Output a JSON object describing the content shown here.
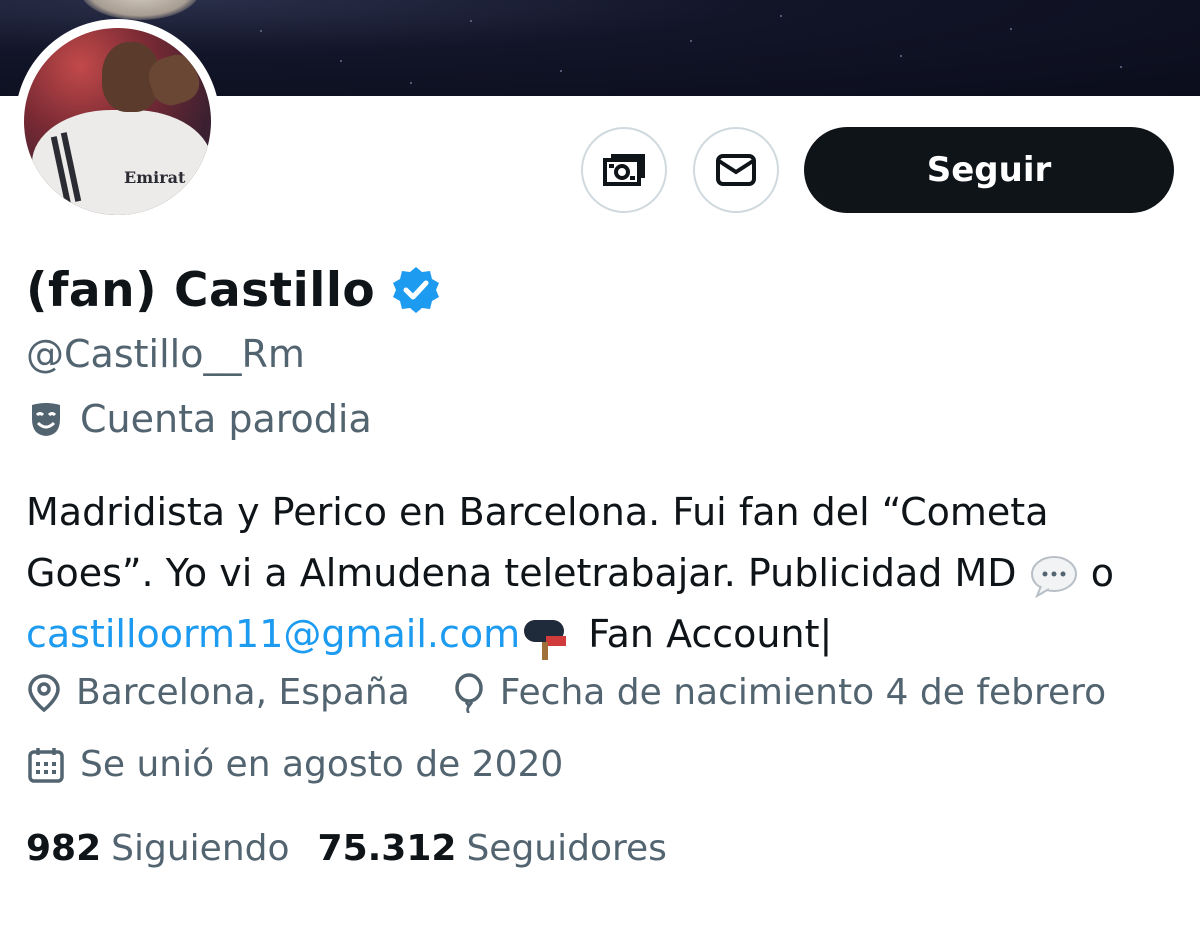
{
  "profile": {
    "name": "(fan) Castillo",
    "handle": "@Castillo__Rm",
    "label": "Cuenta parodia",
    "bio_line1": "Madridista y Perico en Barcelona. Fui fan del “Cometa",
    "bio_line2": "Goes”. Yo vi a Almudena teletrabajar. Publicidad MD",
    "bio_line2_suffix": "o",
    "bio_email": "castilloorm11@gmail.com",
    "bio_line3_suffix": "Fan Account|",
    "location": "Barcelona, España",
    "birthday": "Fecha de nacimiento 4 de febrero",
    "joined": "Se unió en agosto de 2020",
    "following_count": "982",
    "following_label": "Siguiendo",
    "followers_count": "75.312",
    "followers_label": "Seguidores",
    "avatar_jersey_text": "Emirat"
  },
  "actions": {
    "follow_label": "Seguir",
    "icons": [
      "money-icon",
      "mail-icon"
    ]
  },
  "colors": {
    "primary_text": "#0f1419",
    "secondary_text": "#536471",
    "link": "#1d9bf0",
    "verified": "#1d9bf0",
    "follow_button_bg": "#0f1419"
  }
}
